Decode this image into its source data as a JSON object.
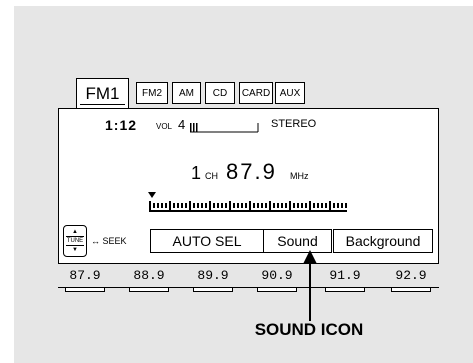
{
  "tabs": [
    "FM1",
    "FM2",
    "AM",
    "CD",
    "CARD",
    "AUX"
  ],
  "status": {
    "clock": "1:12",
    "vol_label": "VOL",
    "vol_value": "4",
    "stereo": "STEREO"
  },
  "tuner": {
    "ch_number": "1",
    "ch_label": "CH",
    "frequency": "87.9",
    "unit": "MHz"
  },
  "tune": {
    "up_glyph": "▲",
    "label": "TUNE",
    "down_glyph": "▼",
    "seek_label": "↔ SEEK"
  },
  "buttons": {
    "auto_sel": "AUTO SEL",
    "sound": "Sound",
    "background": "Background"
  },
  "presets": [
    "87.9",
    "88.9",
    "89.9",
    "90.9",
    "91.9",
    "92.9"
  ],
  "callout": "SOUND ICON"
}
